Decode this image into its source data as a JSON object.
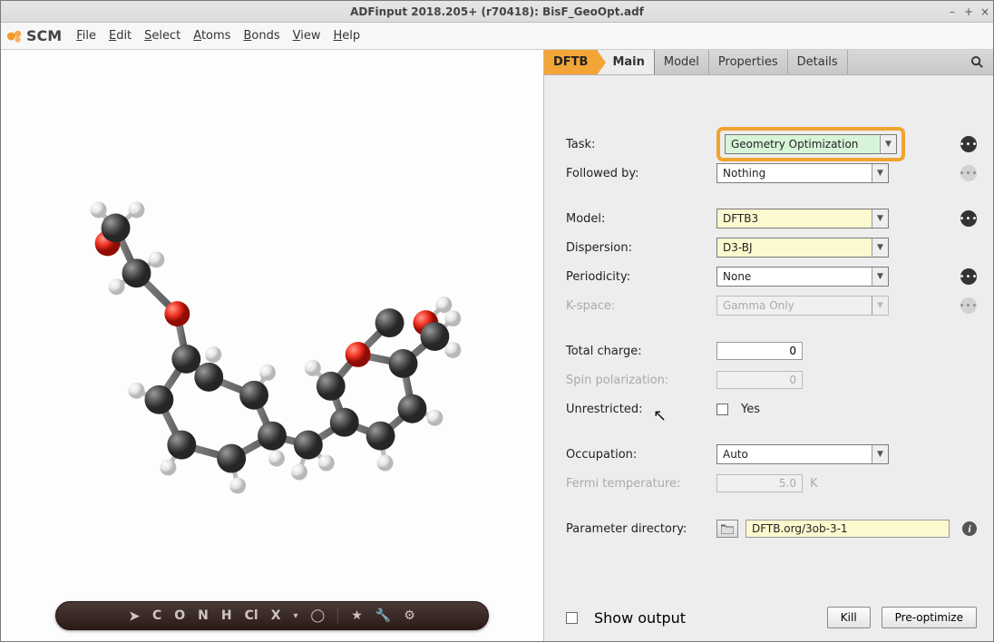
{
  "window_title": "ADFinput 2018.205+ (r70418): BisF_GeoOpt.adf",
  "logo_text": "SCM",
  "menus": [
    "File",
    "Edit",
    "Select",
    "Atoms",
    "Bonds",
    "View",
    "Help"
  ],
  "bottom_toolbar": [
    "C",
    "O",
    "N",
    "H",
    "Cl",
    "X"
  ],
  "tabs": {
    "engine": "DFTB",
    "sections": [
      "Main",
      "Model",
      "Properties",
      "Details"
    ],
    "active": "Main"
  },
  "form": {
    "task": {
      "label": "Task:",
      "value": "Geometry Optimization"
    },
    "followed_by": {
      "label": "Followed by:",
      "value": "Nothing"
    },
    "model": {
      "label": "Model:",
      "value": "DFTB3"
    },
    "dispersion": {
      "label": "Dispersion:",
      "value": "D3-BJ"
    },
    "periodicity": {
      "label": "Periodicity:",
      "value": "None"
    },
    "kspace": {
      "label": "K-space:",
      "value": "Gamma Only"
    },
    "total_charge": {
      "label": "Total charge:",
      "value": "0"
    },
    "spin": {
      "label": "Spin polarization:",
      "value": "0"
    },
    "unrestricted": {
      "label": "Unrestricted:",
      "value": "Yes"
    },
    "occupation": {
      "label": "Occupation:",
      "value": "Auto"
    },
    "fermi": {
      "label": "Fermi temperature:",
      "value": "5.0",
      "unit": "K"
    },
    "param_dir": {
      "label": "Parameter directory:",
      "value": "DFTB.org/3ob-3-1"
    }
  },
  "bottom": {
    "show_output": "Show output",
    "kill": "Kill",
    "preopt": "Pre-optimize"
  }
}
